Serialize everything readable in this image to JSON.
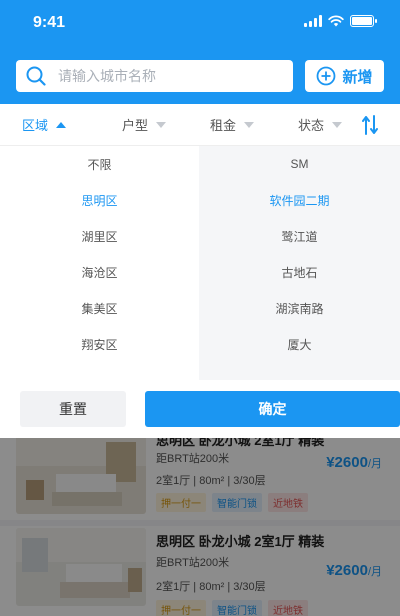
{
  "status_bar": {
    "time": "9:41"
  },
  "header": {
    "search_placeholder": "请输入城市名称",
    "add_label": "新增",
    "colors": {
      "primary": "#1b96f2"
    }
  },
  "filters": {
    "tabs": [
      {
        "label": "区域",
        "active": true
      },
      {
        "label": "户型",
        "active": false
      },
      {
        "label": "租金",
        "active": false
      },
      {
        "label": "状态",
        "active": false
      }
    ]
  },
  "dropdown": {
    "districts": [
      "不限",
      "思明区",
      "湖里区",
      "海沧区",
      "集美区",
      "翔安区"
    ],
    "selected_district": "思明区",
    "areas": [
      "SM",
      "软件园二期",
      "鹭江道",
      "古地石",
      "湖滨南路",
      "厦大"
    ],
    "selected_area": "软件园二期"
  },
  "actions": {
    "reset_label": "重置",
    "confirm_label": "确定"
  },
  "listings": [
    {
      "title": "思明区 卧龙小城 2室1厅 精装",
      "distance": "距BRT站200米",
      "info": "2室1厅 | 80m² | 3/30层",
      "price": "¥2600",
      "unit": "/月",
      "tags": [
        "押一付一",
        "智能门锁",
        "近地铁"
      ]
    },
    {
      "title": "思明区 卧龙小城 2室1厅 精装",
      "distance": "距BRT站200米",
      "info": "2室1厅 | 80m² | 3/30层",
      "price": "¥2600",
      "unit": "/月",
      "tags": [
        "押一付一",
        "智能门锁",
        "近地铁"
      ]
    }
  ]
}
